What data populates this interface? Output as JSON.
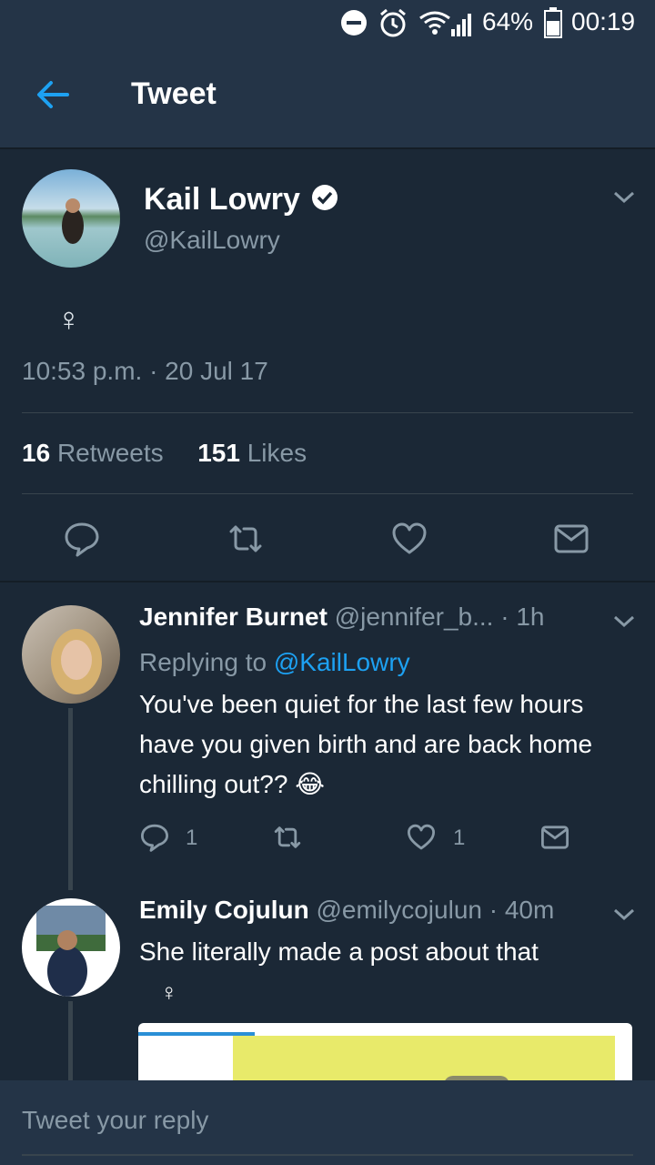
{
  "status_bar": {
    "battery": "64%",
    "time": "00:19"
  },
  "header": {
    "title": "Tweet"
  },
  "tweet": {
    "author_name": "Kail Lowry",
    "author_handle": "@KailLowry",
    "text": "♀",
    "timestamp": "10:53 p.m. · 20 Jul 17",
    "retweets_count": "16",
    "retweets_label": "Retweets",
    "likes_count": "151",
    "likes_label": "Likes"
  },
  "replies": [
    {
      "name": "Jennifer Burnet",
      "handle": "@jennifer_b...",
      "time": "· 1h",
      "replying_prefix": "Replying to",
      "replying_to": "@KailLowry",
      "text": "You've been quiet for the last few hours have you given birth and are back home chilling out?? 😂",
      "reply_count": "1",
      "like_count": "1"
    },
    {
      "name": "Emily Cojulun",
      "handle": "@emilycojulun",
      "time": "· 40m",
      "text": "She literally made a post about that",
      "symbol": "♀"
    }
  ],
  "compose": {
    "placeholder": "Tweet your reply"
  },
  "colors": {
    "background": "#1b2836",
    "header": "#243447",
    "accent": "#1da1f2",
    "muted": "#8899a6"
  }
}
